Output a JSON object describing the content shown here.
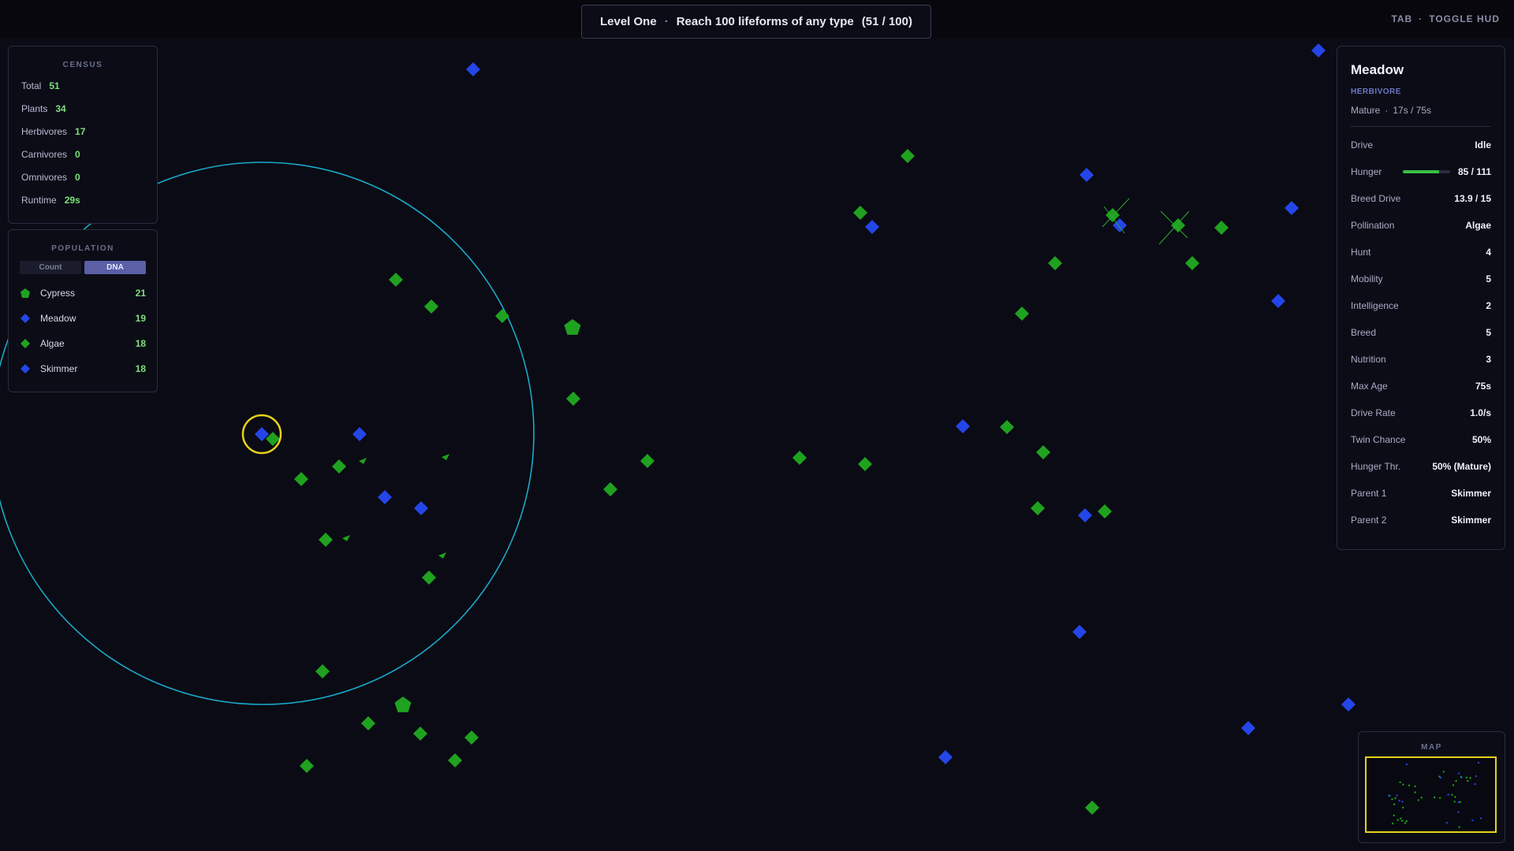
{
  "objective": {
    "level": "Level One",
    "separator": "·",
    "goal": "Reach 100 lifeforms of any type",
    "progress": "(51 / 100)"
  },
  "hud_hint": {
    "key": "TAB",
    "separator": "·",
    "action": "TOGGLE HUD"
  },
  "census": {
    "title": "CENSUS",
    "rows": [
      {
        "label": "Total",
        "value": "51"
      },
      {
        "label": "Plants",
        "value": "34"
      },
      {
        "label": "Herbivores",
        "value": "17"
      },
      {
        "label": "Carnivores",
        "value": "0"
      },
      {
        "label": "Omnivores",
        "value": "0"
      },
      {
        "label": "Runtime",
        "value": "29s"
      }
    ]
  },
  "population": {
    "title": "POPULATION",
    "toggle": {
      "count": "Count",
      "dna": "DNA",
      "active": "DNA"
    },
    "species": [
      {
        "name": "Cypress",
        "count": "21",
        "shape": "pentagon",
        "color": "#1fa21f"
      },
      {
        "name": "Meadow",
        "count": "19",
        "shape": "diamond",
        "color": "#2446e8"
      },
      {
        "name": "Algae",
        "count": "18",
        "shape": "diamond",
        "color": "#1fa21f"
      },
      {
        "name": "Skimmer",
        "count": "18",
        "shape": "diamond",
        "color": "#2446e8"
      }
    ]
  },
  "details": {
    "name": "Meadow",
    "type": "HERBIVORE",
    "stage": "Mature",
    "stage_sep": "·",
    "age": "17s / 75s",
    "hunger_fraction": 0.77,
    "rows": [
      {
        "label": "Drive",
        "value": "Idle"
      },
      {
        "label": "Hunger",
        "value": "85 / 111"
      },
      {
        "label": "Breed Drive",
        "value": "13.9 / 15"
      },
      {
        "label": "Pollination",
        "value": "Algae"
      },
      {
        "label": "Hunt",
        "value": "4"
      },
      {
        "label": "Mobility",
        "value": "5"
      },
      {
        "label": "Intelligence",
        "value": "2"
      },
      {
        "label": "Breed",
        "value": "5"
      },
      {
        "label": "Nutrition",
        "value": "3"
      },
      {
        "label": "Max Age",
        "value": "75s"
      },
      {
        "label": "Drive Rate",
        "value": "1.0/s"
      },
      {
        "label": "Twin Chance",
        "value": "50%"
      },
      {
        "label": "Hunger Thr.",
        "value": "50% (Mature)"
      },
      {
        "label": "Parent 1",
        "value": "Skimmer"
      },
      {
        "label": "Parent 2",
        "value": "Skimmer"
      }
    ]
  },
  "minimap": {
    "title": "MAP"
  },
  "colors": {
    "plant": "#1fa21f",
    "herbivore": "#2446e8",
    "selection_ring": "#e8d21a",
    "sense_radius": "#1aa9c9",
    "background": "#0a0b14"
  }
}
